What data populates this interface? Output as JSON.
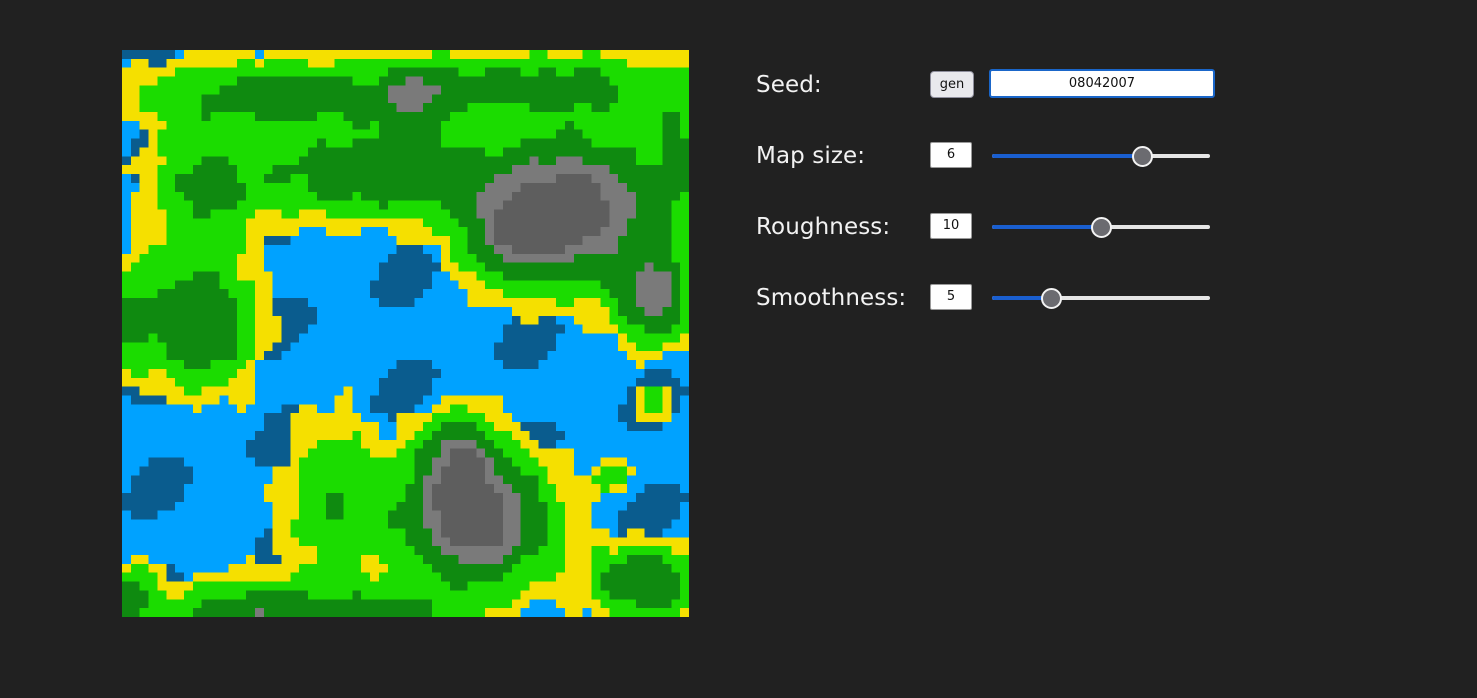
{
  "seed": {
    "label": "Seed:",
    "gen_label": "gen",
    "value": "08042007"
  },
  "map_size": {
    "label": "Map size:",
    "value": "6",
    "slider_fraction": 0.69
  },
  "roughness": {
    "label": "Roughness:",
    "value": "10",
    "slider_fraction": 0.5
  },
  "smoothness": {
    "label": "Smoothness:",
    "value": "5",
    "slider_fraction": 0.27
  },
  "terrain_colors": {
    "deep_water": "#0a5c8e",
    "water": "#00a2ff",
    "sand": "#f5e000",
    "grass": "#1bdc00",
    "forest": "#0f8a10",
    "rock": "#7a7a7a",
    "peak": "#5e5e5e"
  }
}
